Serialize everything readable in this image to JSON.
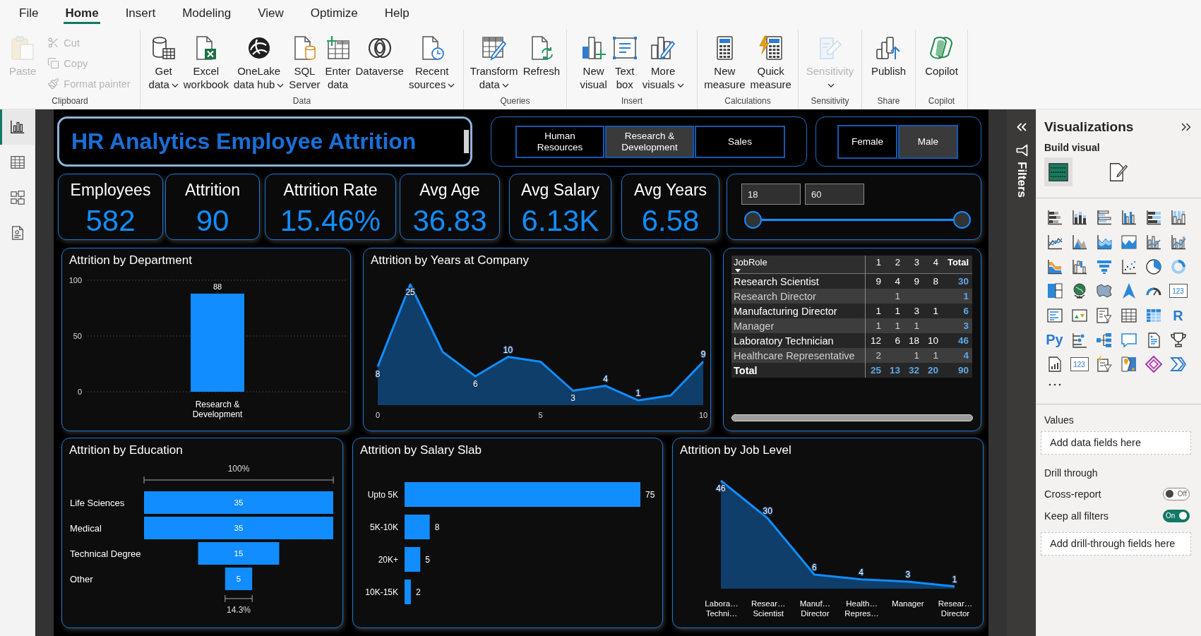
{
  "menu_tabs": [
    {
      "label": "File",
      "selected": false
    },
    {
      "label": "Home",
      "selected": true
    },
    {
      "label": "Insert",
      "selected": false
    },
    {
      "label": "Modeling",
      "selected": false
    },
    {
      "label": "View",
      "selected": false
    },
    {
      "label": "Optimize",
      "selected": false
    },
    {
      "label": "Help",
      "selected": false
    }
  ],
  "ribbon": [
    {
      "label": "Clipboard",
      "buttons": [
        {
          "kind": "large",
          "lines": [
            "Paste"
          ],
          "dropdown": false,
          "disabled": true
        },
        {
          "kind": "small",
          "lines": [
            "Cut"
          ],
          "dropdown": false,
          "disabled": true
        },
        {
          "kind": "small",
          "lines": [
            "Copy"
          ],
          "dropdown": false,
          "disabled": true
        },
        {
          "kind": "small",
          "lines": [
            "Format painter"
          ],
          "dropdown": false,
          "disabled": true
        }
      ]
    },
    {
      "label": "Data",
      "buttons": [
        {
          "kind": "large",
          "lines": [
            "Get",
            "data"
          ],
          "dropdown": true,
          "disabled": false
        },
        {
          "kind": "large",
          "lines": [
            "Excel",
            "workbook"
          ],
          "dropdown": false,
          "disabled": false
        },
        {
          "kind": "large",
          "lines": [
            "OneLake",
            "data hub"
          ],
          "dropdown": true,
          "disabled": false
        },
        {
          "kind": "large",
          "lines": [
            "SQL",
            "Server"
          ],
          "dropdown": false,
          "disabled": false
        },
        {
          "kind": "large",
          "lines": [
            "Enter",
            "data"
          ],
          "dropdown": false,
          "disabled": false
        },
        {
          "kind": "large",
          "lines": [
            "Dataverse"
          ],
          "dropdown": false,
          "disabled": false
        },
        {
          "kind": "large",
          "lines": [
            "Recent",
            "sources"
          ],
          "dropdown": true,
          "disabled": false
        }
      ]
    },
    {
      "label": "Queries",
      "buttons": [
        {
          "kind": "large",
          "lines": [
            "Transform",
            "data"
          ],
          "dropdown": true,
          "disabled": false
        },
        {
          "kind": "large",
          "lines": [
            "Refresh"
          ],
          "dropdown": false,
          "disabled": false
        }
      ]
    },
    {
      "label": "Insert",
      "buttons": [
        {
          "kind": "large",
          "lines": [
            "New",
            "visual"
          ],
          "dropdown": false,
          "disabled": false
        },
        {
          "kind": "large",
          "lines": [
            "Text",
            "box"
          ],
          "dropdown": false,
          "disabled": false
        },
        {
          "kind": "large",
          "lines": [
            "More",
            "visuals"
          ],
          "dropdown": true,
          "disabled": false
        }
      ]
    },
    {
      "label": "Calculations",
      "buttons": [
        {
          "kind": "large",
          "lines": [
            "New",
            "measure"
          ],
          "dropdown": false,
          "disabled": false
        },
        {
          "kind": "large",
          "lines": [
            "Quick",
            "measure"
          ],
          "dropdown": false,
          "disabled": false
        }
      ]
    },
    {
      "label": "Sensitivity",
      "buttons": [
        {
          "kind": "large",
          "lines": [
            "Sensitivity"
          ],
          "dropdown": true,
          "disabled": true
        }
      ]
    },
    {
      "label": "Share",
      "buttons": [
        {
          "kind": "large",
          "lines": [
            "Publish"
          ],
          "dropdown": false,
          "disabled": false
        }
      ]
    },
    {
      "label": "Copilot",
      "buttons": [
        {
          "kind": "large",
          "lines": [
            "Copilot"
          ],
          "dropdown": false,
          "disabled": false
        }
      ]
    }
  ],
  "view_switcher": [
    {
      "selected": true
    },
    {
      "selected": false
    },
    {
      "selected": false
    },
    {
      "selected": false
    }
  ],
  "report": {
    "title": "HR Analytics Employee Attrition",
    "department_slicer": [
      {
        "lines": [
          "Human",
          "Resources"
        ],
        "selected": false
      },
      {
        "lines": [
          "Research &",
          "Development"
        ],
        "selected": true
      },
      {
        "lines": [
          "Sales"
        ],
        "selected": false
      }
    ],
    "gender_slicer": [
      {
        "label": "Female",
        "selected": false
      },
      {
        "label": "Male",
        "selected": true
      }
    ],
    "kpi_cards": [
      {
        "label": "Employees",
        "value": "582"
      },
      {
        "label": "Attrition",
        "value": "90"
      },
      {
        "label": "Attrition Rate",
        "value": "15.46%"
      },
      {
        "label": "Avg Age",
        "value": "36.83"
      },
      {
        "label": "Avg Salary",
        "value": "6.13K"
      },
      {
        "label": "Avg Years",
        "value": "6.58"
      }
    ],
    "age_slider": {
      "inputs": [
        "18",
        "60"
      ],
      "handles": [
        {
          "level": 0
        },
        {
          "level": 1
        }
      ]
    },
    "attrition_by_department": {
      "title": "Attrition by Department",
      "chart_data": {
        "type": "bar",
        "categories": [
          "Research & Development"
        ],
        "values": [
          88
        ],
        "color": "#118dff",
        "yticks": [
          0,
          50,
          100
        ],
        "ylim": [
          0,
          100
        ],
        "data_labels": true,
        "grid": true
      }
    },
    "attrition_by_years": {
      "title": "Attrition by Years at Company",
      "chart_data": {
        "type": "area",
        "x": [
          0,
          1,
          2,
          3,
          4,
          5,
          6,
          7,
          8,
          9,
          10
        ],
        "values": [
          8,
          25,
          11,
          6,
          10,
          9,
          3,
          4,
          1,
          2,
          9
        ],
        "color": "#118dff",
        "xticks": [
          0,
          5,
          10
        ],
        "xlim": [
          0,
          10
        ],
        "tick_labels": "x",
        "value_labels": [
          "8",
          "25",
          null,
          "6",
          "10",
          null,
          "3",
          "4",
          "1",
          null,
          "9"
        ]
      }
    },
    "job_role_matrix": {
      "columns": [
        "JobRole",
        "1",
        "2",
        "3",
        "4",
        "Total"
      ],
      "sorted": true,
      "rows": [
        [
          "Research Scientist",
          "9",
          "4",
          "9",
          "8",
          "30"
        ],
        [
          "Research Director",
          null,
          "1",
          null,
          null,
          "1"
        ],
        [
          "Manufacturing Director",
          "1",
          "1",
          "3",
          "1",
          "6"
        ],
        [
          "Manager",
          "1",
          "1",
          "1",
          null,
          "3"
        ],
        [
          "Laboratory Technician",
          "12",
          "6",
          "18",
          "10",
          "46"
        ],
        [
          "Healthcare Representative",
          "2",
          null,
          "1",
          "1",
          "4"
        ]
      ],
      "total_row": [
        "Total",
        "25",
        "13",
        "32",
        "20",
        "90"
      ]
    },
    "attrition_by_education": {
      "title": "Attrition by Education",
      "chart_data": {
        "type": "other",
        "categories": [
          "Life Sciences",
          "Medical",
          "Technical Degree",
          "Other"
        ],
        "values": [
          35,
          35,
          15,
          5
        ],
        "color": "#118dff",
        "data_labels": true,
        "annotations": [
          "100%",
          "14.3%"
        ]
      }
    },
    "attrition_by_salary_slab": {
      "title": "Attrition by Salary Slab",
      "chart_data": {
        "type": "bar",
        "orientation": "horizontal",
        "categories": [
          "Upto 5K",
          "5K-10K",
          "20K+",
          "10K-15K"
        ],
        "values": [
          75,
          8,
          5,
          2
        ],
        "color": "#118dff",
        "tick_labels": "y",
        "data_labels": true
      }
    },
    "attrition_by_job_level": {
      "title": "Attrition by Job Level",
      "chart_data": {
        "type": "area",
        "categories": [
          "Labora… Techni…",
          "Resear… Scientist",
          "Manuf… Director",
          "Health… Repres…",
          "Manager",
          "Resear… Director"
        ],
        "values": [
          46,
          30,
          6,
          4,
          3,
          1
        ],
        "color": "#118dff",
        "tick_labels": "x",
        "data_labels": true
      }
    }
  },
  "filters_pane": {
    "title": "Filters"
  },
  "visualizations_pane": {
    "title": "Visualizations",
    "section": "Build visual",
    "tabs": [
      {
        "selected": true
      },
      {
        "selected": false
      }
    ],
    "visual_types": [
      {
        "kind": "chart"
      },
      {
        "kind": "chart"
      },
      {
        "kind": "chart"
      },
      {
        "kind": "chart"
      },
      {
        "kind": "chart"
      },
      {
        "kind": "chart"
      },
      {
        "kind": "chart"
      },
      {
        "kind": "chart"
      },
      {
        "kind": "chart"
      },
      {
        "kind": "chart"
      },
      {
        "kind": "chart"
      },
      {
        "kind": "chart"
      },
      {
        "kind": "chart"
      },
      {
        "kind": "chart"
      },
      {
        "kind": "chart"
      },
      {
        "kind": "chart"
      },
      {
        "kind": "chart"
      },
      {
        "kind": "chart"
      },
      {
        "kind": "chart"
      },
      {
        "kind": "chart"
      },
      {
        "kind": "chart"
      },
      {
        "kind": "chart"
      },
      {
        "kind": "chart"
      },
      {
        "kind": "card",
        "text": "123"
      },
      {
        "kind": "chart"
      },
      {
        "kind": "chart"
      },
      {
        "kind": "chart"
      },
      {
        "kind": "chart"
      },
      {
        "kind": "chart"
      },
      {
        "kind": "letter",
        "text": "R"
      },
      {
        "kind": "letter",
        "text": "Py"
      },
      {
        "kind": "chart"
      },
      {
        "kind": "chart"
      },
      {
        "kind": "chart"
      },
      {
        "kind": "chart"
      },
      {
        "kind": "chart"
      },
      {
        "kind": "chart"
      },
      {
        "kind": "card",
        "text": "123"
      },
      {
        "kind": "chart"
      },
      {
        "kind": "chart"
      },
      {
        "kind": "chart"
      },
      {
        "kind": "chart"
      }
    ],
    "values": {
      "label": "Values",
      "placeholder": "Add data fields here"
    },
    "drill_through": {
      "label": "Drill through",
      "toggles": [
        {
          "label": "Cross-report",
          "on": false,
          "state_text": "Off"
        },
        {
          "label": "Keep all filters",
          "on": true,
          "state_text": "On"
        }
      ],
      "placeholder": "Add drill-through fields here"
    }
  }
}
